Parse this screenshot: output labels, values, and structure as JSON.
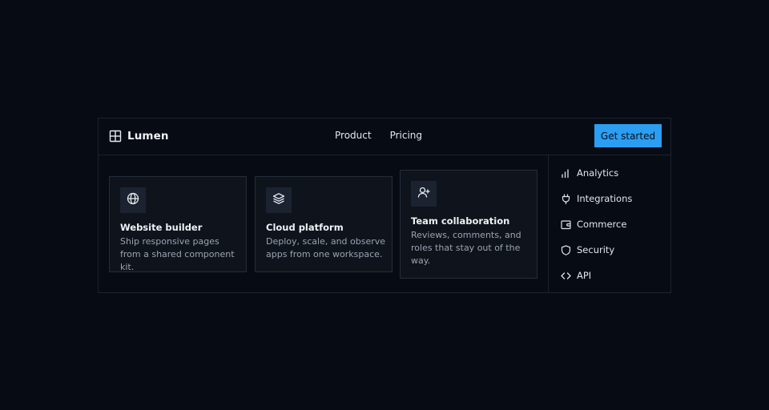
{
  "brand": {
    "name": "Lumen",
    "icon": "layout-grid-plus-icon"
  },
  "nav": {
    "links": [
      "Product",
      "Pricing"
    ],
    "cta_label": "Get started"
  },
  "cards": [
    {
      "icon": "globe-icon",
      "title": "Website builder",
      "description": "Ship responsive pages from a shared component kit."
    },
    {
      "icon": "layers-icon",
      "title": "Cloud platform",
      "description": "Deploy, scale, and observe apps from one workspace."
    },
    {
      "icon": "user-plus-icon",
      "title": "Team collaboration",
      "description": "Reviews, comments, and roles that stay out of the way."
    }
  ],
  "side_links": [
    {
      "icon": "bar-chart-icon",
      "label": "Analytics"
    },
    {
      "icon": "plug-icon",
      "label": "Integrations"
    },
    {
      "icon": "wallet-icon",
      "label": "Commerce"
    },
    {
      "icon": "shield-icon",
      "label": "Security"
    },
    {
      "icon": "code-icon",
      "label": "API"
    }
  ],
  "colors": {
    "background": "#070b13",
    "card": "#0f141c",
    "accent": "#2b9ef2",
    "border": "#1c2330"
  }
}
